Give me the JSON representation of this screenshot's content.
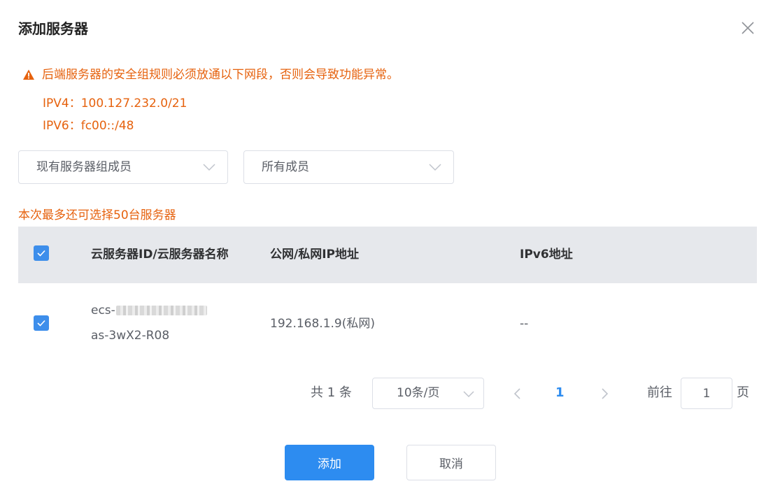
{
  "dialog": {
    "title": "添加服务器",
    "close_icon": "close-icon"
  },
  "warning": {
    "icon": "warning-icon",
    "message": "后端服务器的安全组规则必须放通以下网段，否则会导致功能异常。",
    "ipv4": "IPV4：100.127.232.0/21",
    "ipv6": "IPV6：fc00::/48"
  },
  "filters": {
    "group_select": "现有服务器组成员",
    "member_select": "所有成员"
  },
  "limit_text": "本次最多还可选择50台服务器",
  "table": {
    "columns": [
      "云服务器ID/云服务器名称",
      "公网/私网IP地址",
      "IPv6地址"
    ],
    "rows": [
      {
        "checked": true,
        "id_prefix": "ecs-",
        "name": "as-3wX2-R08",
        "ip": "192.168.1.9(私网)",
        "ipv6": "--"
      }
    ]
  },
  "pagination": {
    "total": "共 1 条",
    "page_size": "10条/页",
    "current_page": "1",
    "goto_label": "前往",
    "goto_value": "1",
    "page_unit": "页"
  },
  "footer": {
    "add_label": "添加",
    "cancel_label": "取消"
  },
  "colors": {
    "warning": "#e6620e",
    "primary": "#2d8cf0",
    "checkbox": "#3d8eeb",
    "header_bg": "#e6e8ec"
  }
}
